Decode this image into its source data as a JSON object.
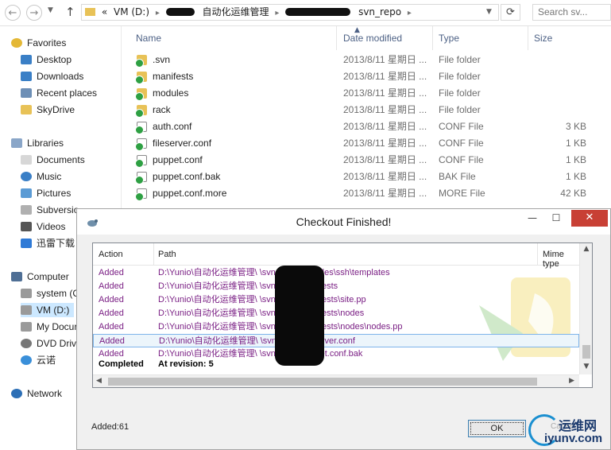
{
  "explorer": {
    "address": {
      "overflow": "«",
      "crumbs": [
        "VM (D:)",
        "自动化运维管理",
        "svn_repo"
      ],
      "search_placeholder": "Search sv..."
    },
    "nav": {
      "favorites": "Favorites",
      "desktop": "Desktop",
      "downloads": "Downloads",
      "recent": "Recent places",
      "skydrive": "SkyDrive",
      "libraries": "Libraries",
      "documents": "Documents",
      "music": "Music",
      "pictures": "Pictures",
      "subversion": "Subversio",
      "videos": "Videos",
      "xunlei": "迅雷下载",
      "computer": "Computer",
      "system": "system (C",
      "vm": "VM (D:)",
      "mydocs": "My Docur",
      "dvd": "DVD Drive",
      "yunuo": "云诺",
      "network": "Network"
    },
    "columns": {
      "name": "Name",
      "date": "Date modified",
      "type": "Type",
      "size": "Size"
    },
    "files": [
      {
        "name": ".svn",
        "date": "2013/8/11 星期日 ...",
        "type": "File folder",
        "size": "",
        "kind": "folder"
      },
      {
        "name": "manifests",
        "date": "2013/8/11 星期日 ...",
        "type": "File folder",
        "size": "",
        "kind": "folder"
      },
      {
        "name": "modules",
        "date": "2013/8/11 星期日 ...",
        "type": "File folder",
        "size": "",
        "kind": "folder"
      },
      {
        "name": "rack",
        "date": "2013/8/11 星期日 ...",
        "type": "File folder",
        "size": "",
        "kind": "folder"
      },
      {
        "name": "auth.conf",
        "date": "2013/8/11 星期日 ...",
        "type": "CONF File",
        "size": "3 KB",
        "kind": "file"
      },
      {
        "name": "fileserver.conf",
        "date": "2013/8/11 星期日 ...",
        "type": "CONF File",
        "size": "1 KB",
        "kind": "file"
      },
      {
        "name": "puppet.conf",
        "date": "2013/8/11 星期日 ...",
        "type": "CONF File",
        "size": "1 KB",
        "kind": "file"
      },
      {
        "name": "puppet.conf.bak",
        "date": "2013/8/11 星期日 ...",
        "type": "BAK File",
        "size": "1 KB",
        "kind": "file"
      },
      {
        "name": "puppet.conf.more",
        "date": "2013/8/11 星期日 ...",
        "type": "MORE File",
        "size": "42 KB",
        "kind": "file"
      }
    ]
  },
  "dialog": {
    "title": "Checkout Finished!",
    "columns": {
      "action": "Action",
      "path": "Path",
      "mime": "Mime type"
    },
    "rows": [
      {
        "action": "Added",
        "path": "D:\\Yunio\\自动化运维管理\\                    \\svn_repo\\modules\\ssh\\templates"
      },
      {
        "action": "Added",
        "path": "D:\\Yunio\\自动化运维管理\\                    \\svn_repo\\manifests"
      },
      {
        "action": "Added",
        "path": "D:\\Yunio\\自动化运维管理\\                    \\svn_repo\\manifests\\site.pp"
      },
      {
        "action": "Added",
        "path": "D:\\Yunio\\自动化运维管理\\                    \\svn_repo\\manifests\\nodes"
      },
      {
        "action": "Added",
        "path": "D:\\Yunio\\自动化运维管理\\                    \\svn_repo\\manifests\\nodes\\nodes.pp"
      },
      {
        "action": "Added",
        "path": "D:\\Yunio\\自动化运维管理\\                    \\svn_repo\\fileserver.conf"
      },
      {
        "action": "Added",
        "path": "D:\\Yunio\\自动化运维管理\\                    \\svn_repo\\puppet.conf.bak"
      }
    ],
    "completed": {
      "action": "Completed",
      "path": "At revision: 5"
    },
    "status": "Added:61",
    "ok_label": "OK",
    "cancel_ghost": "Cancel"
  },
  "brand": {
    "cn": "运维网",
    "url": "iyunv.com"
  },
  "colors": {
    "added": "#7a1f84",
    "close": "#c84035",
    "folder": "#e8c257",
    "header": "#4d6185"
  }
}
